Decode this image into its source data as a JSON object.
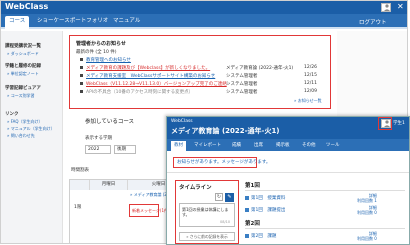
{
  "back": {
    "brand": "WebClass",
    "nav": {
      "tabs": [
        "コース",
        "ショーケースポートフォリオ",
        "マニュアル"
      ],
      "logout": "ログアウト"
    },
    "sidebar": {
      "sections": [
        {
          "heading": "課程受講状況一覧",
          "link": "» ダッシュボード"
        },
        {
          "heading": "学籍と履修の記録",
          "link": "» 単位認定ノート"
        },
        {
          "heading": "学習記録ビュアア",
          "link": "» コース別学習"
        },
        {
          "heading": "リンク",
          "links": [
            "» FAQ（学生向け）",
            "» マニュアル（学生向け）",
            "» 問い合わせ先"
          ]
        }
      ]
    },
    "notice": {
      "title": "管理者からのお知らせ",
      "latest": "最新の件 (全 10 件)",
      "rows": [
        {
          "text": "教育管理へのお知らせ",
          "category": "",
          "date": "",
          "style": "blue"
        },
        {
          "text": "メディア教育の課題及び【Webclass】が新しくなりました。",
          "category": "メディア教育論 (2022-通年-火1)",
          "date": "12/26",
          "style": "red"
        },
        {
          "text": "メディア教育支援室　WebClassサポートサイト構築のお知らせ",
          "category": "システム管理者",
          "date": "12/15",
          "style": "blue"
        },
        {
          "text": "WebClass（V11.12.28→V11.13.0）バージョンアップ完了のご連絡",
          "category": "システム管理者",
          "date": "12/11",
          "style": "red"
        },
        {
          "text": "APIの不具合（10番のアクセス時刻に関する変更点）",
          "category": "システム管理者",
          "date": "12/09",
          "style": "gray"
        }
      ],
      "more": "» お知らせ一覧"
    },
    "courses": {
      "heading": "参加しているコース",
      "year_label": "表示する学期",
      "year_value": "2022",
      "term_value": "後期",
      "timetable_label": "時間割表",
      "tbl_head_period": "",
      "tbl_head_mon": "月曜日",
      "tbl_head_tue": "火曜日",
      "row_label": "1限",
      "tue_course": "» メディア教育論 (2022-通年",
      "tue_new": "新着メッセージ(1件)"
    }
  },
  "front": {
    "brand": "WebClass",
    "course_title": "メディア教育論 (2022-通年-火1)",
    "user_name": "学生1",
    "tabs": [
      "教材",
      "マイレポート",
      "成績",
      "出席",
      "掲示板",
      "その他",
      "ツール"
    ],
    "message": "お知らせがあります。メッセージがあります。",
    "timeline": {
      "title": "タイムライン",
      "refresh_glyph": "↻",
      "edit_glyph": "✎",
      "post_text": "第1回の授業は休講にします。",
      "post_count": "08/10",
      "more_label": "» さらに前の記録を表示"
    },
    "weeks": [
      {
        "title": "第1回",
        "items": [
          {
            "label": "第1回　授業資料",
            "status": "詳細\n利用回数 1"
          },
          {
            "label": "第1回　課題提出",
            "status": "詳細\n利用回数 0"
          }
        ]
      },
      {
        "title": "第2回",
        "items": [
          {
            "label": "第2回　課題",
            "status": "詳細\n利用回数 0"
          }
        ]
      }
    ]
  }
}
